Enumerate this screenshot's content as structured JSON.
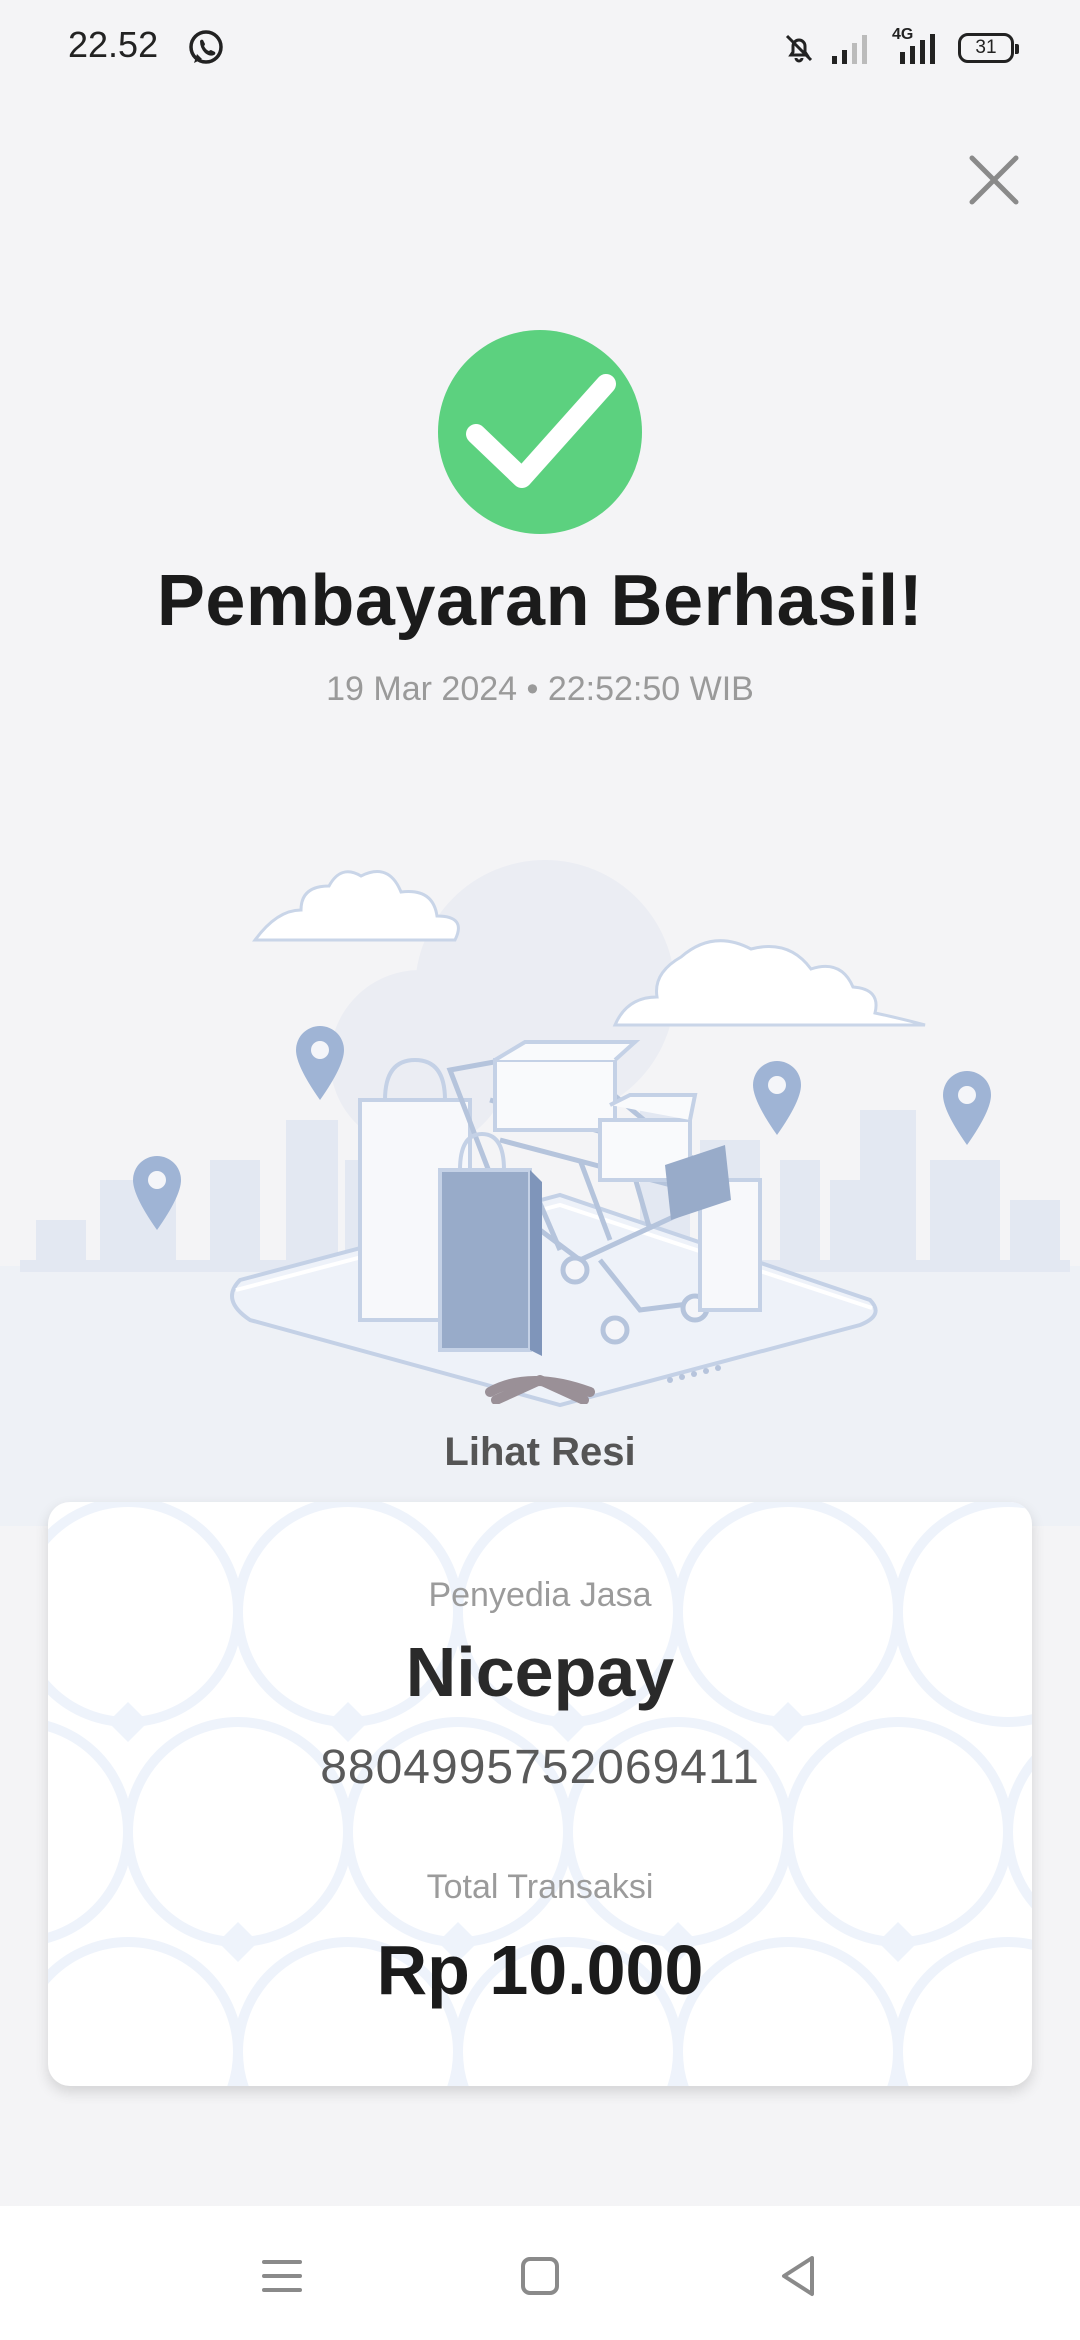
{
  "status_bar": {
    "time": "22.52",
    "network": "4G",
    "battery": "31",
    "icons": [
      "whatsapp-icon",
      "bell-off-icon",
      "signal-icon",
      "signal-4g-icon",
      "battery-icon"
    ]
  },
  "header": {
    "close_icon": "close-icon"
  },
  "result": {
    "title": "Pembayaran Berhasil!",
    "datetime": "19 Mar 2024 • 22:52:50 WIB",
    "status_icon": "check-icon",
    "accent_color": "#5cd17f"
  },
  "receipt": {
    "toggle_label": "Lihat Resi",
    "provider_label": "Penyedia Jasa",
    "provider_name": "Nicepay",
    "account_number": "8804995752069411",
    "total_label": "Total Transaksi",
    "total_amount": "Rp 10.000"
  },
  "nav": {
    "icons": [
      "menu-icon",
      "home-square-icon",
      "back-triangle-icon"
    ]
  }
}
